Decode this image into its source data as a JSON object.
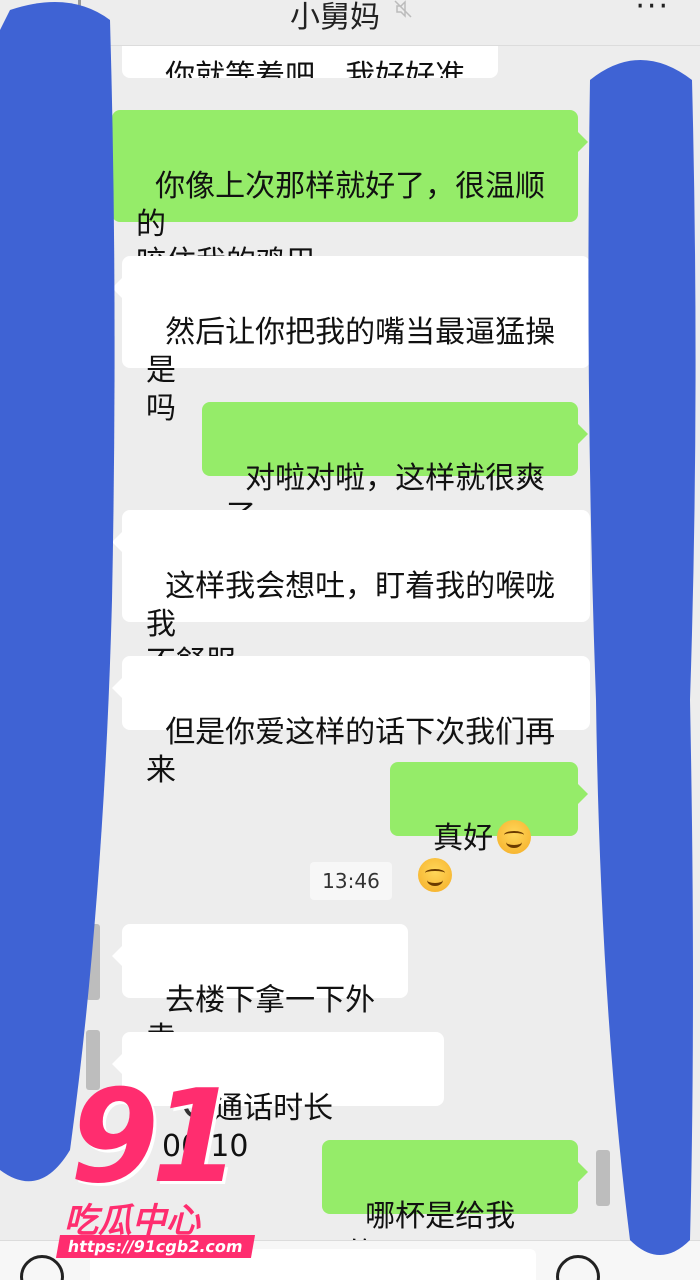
{
  "header": {
    "title": "小舅妈",
    "mute_icon": "mute-icon",
    "more_icon": "more-dots-icon",
    "more_label": "···"
  },
  "messages": [
    {
      "id": "m0",
      "side": "in",
      "text": "你就等着吧，我好好准备"
    },
    {
      "id": "m1",
      "side": "out",
      "text": "你像上次那样就好了，很温顺的\n咬住我的鸡巴"
    },
    {
      "id": "m2",
      "side": "in",
      "text": "然后让你把我的嘴当最逼猛操是\n吗"
    },
    {
      "id": "m3",
      "side": "out",
      "text": "对啦对啦，这样就很爽了"
    },
    {
      "id": "m4",
      "side": "in",
      "text": "这样我会想吐，盯着我的喉咙我\n不舒服"
    },
    {
      "id": "m5",
      "side": "in",
      "text": "但是你爱这样的话下次我们再来"
    },
    {
      "id": "m6",
      "side": "out",
      "text": "真好",
      "emojis": 2
    },
    {
      "id": "m7",
      "side": "in",
      "text": "去楼下拿一下外卖"
    },
    {
      "id": "m8",
      "side": "in",
      "text": "通话时长 00:10",
      "icon": "phone-call-icon"
    },
    {
      "id": "m9",
      "side": "out",
      "text": "哪杯是给我的？",
      "emojis": 1
    }
  ],
  "timestamp": "13:46",
  "watermark": {
    "number": "91",
    "subtitle": "吃瓜中心",
    "url": "https://91cgb2.com"
  },
  "colors": {
    "bg": "#ededed",
    "incoming": "#ffffff",
    "outgoing": "#95ec69",
    "redaction": "#3f63d4",
    "watermark": "#ff2d6f"
  }
}
